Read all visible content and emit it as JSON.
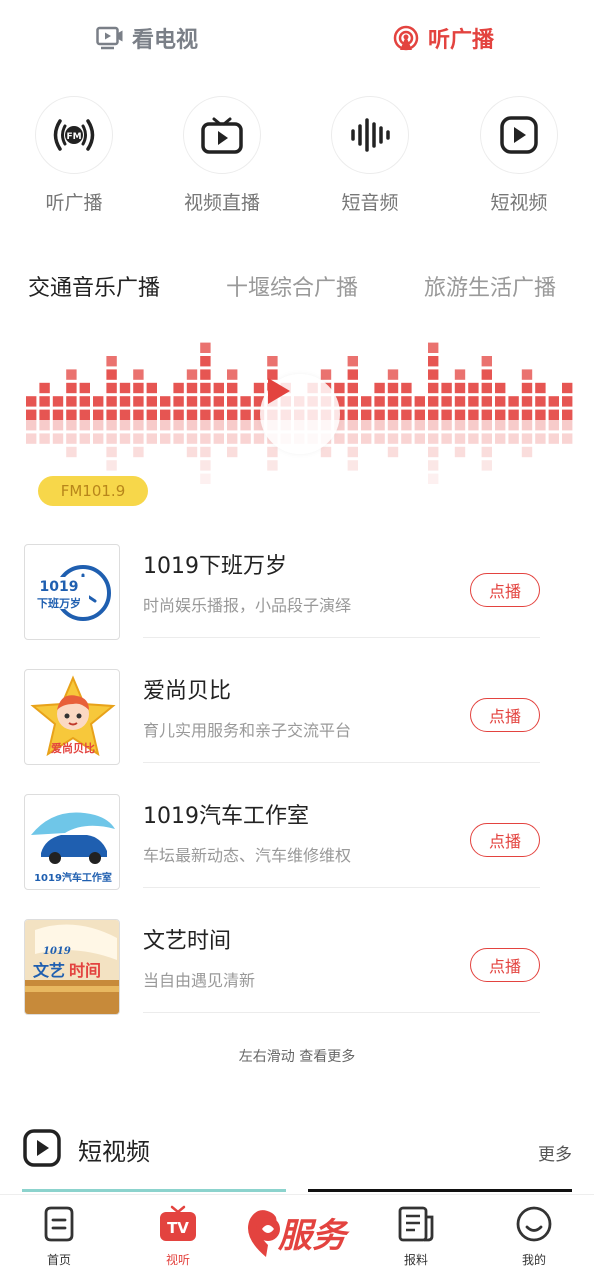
{
  "top_tabs": {
    "tv_label": "看电视",
    "radio_label": "听广播"
  },
  "categories": [
    {
      "label": "听广播",
      "icon": "fm-radio-icon"
    },
    {
      "label": "视频直播",
      "icon": "tv-icon"
    },
    {
      "label": "短音频",
      "icon": "sound-wave-icon"
    },
    {
      "label": "短视频",
      "icon": "play-square-icon"
    }
  ],
  "station_tabs": [
    {
      "label": "交通音乐广播",
      "active": true
    },
    {
      "label": "十堰综合广播",
      "active": false
    },
    {
      "label": "旅游生活广播",
      "active": false
    }
  ],
  "player": {
    "frequency": "FM101.9",
    "accent": "#e3433f"
  },
  "programs": [
    {
      "title": "1019下班万岁",
      "desc": "时尚娱乐播报，小品段子演绎",
      "button": "点播",
      "logo_text": "1019 下班万岁"
    },
    {
      "title": "爱尚贝比",
      "desc": "育儿实用服务和亲子交流平台",
      "button": "点播",
      "logo_text": "爱尚贝比"
    },
    {
      "title": "1019汽车工作室",
      "desc": "车坛最新动态、汽车维修维权",
      "button": "点播",
      "logo_text": "1019汽车工作室"
    },
    {
      "title": "文艺时间",
      "desc": "当自由遇见清新",
      "button": "点播",
      "logo_text": "1019 文艺时间"
    }
  ],
  "more_hint": "左右滑动 查看更多",
  "short_video": {
    "title": "短视频",
    "more": "更多"
  },
  "bottom_nav": {
    "home": "首页",
    "video": "视听",
    "video_badge": "TV",
    "service": "服务",
    "report": "报料",
    "me": "我的"
  }
}
